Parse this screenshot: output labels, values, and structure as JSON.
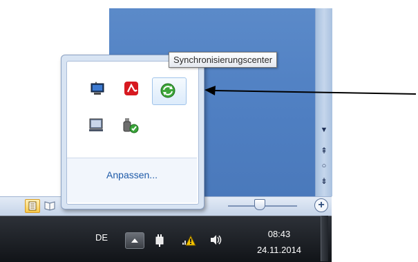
{
  "tooltip": {
    "text": "Synchronisierungscenter"
  },
  "popup": {
    "customize_label": "Anpassen...",
    "icons": [
      "network-monitor-icon",
      "avira-antivirus-icon",
      "sync-center-icon",
      "laptop-display-icon",
      "usb-safely-remove-icon"
    ]
  },
  "taskbar": {
    "language": "DE",
    "show_hidden_icon": "triangle-up-icon",
    "tray_icons": [
      "power-plug-icon",
      "network-warning-icon",
      "speaker-volume-icon"
    ],
    "time": "08:43",
    "date": "24.11.2014"
  },
  "background_window": {
    "scroll_icons": [
      "scroll-down-arrow-icon",
      "previous-page-icon",
      "select-browse-object-icon",
      "next-page-icon"
    ],
    "view_icons": [
      "print-layout-icon",
      "reading-view-icon"
    ],
    "zoom_icon": "zoom-in-icon"
  },
  "annotation": {
    "arrow_color": "#000000"
  },
  "colors": {
    "taskbar": "#1a1d22",
    "popup_background": "#ffffff",
    "link": "#1e5aa8",
    "window_blue": "#4f7fc2"
  }
}
